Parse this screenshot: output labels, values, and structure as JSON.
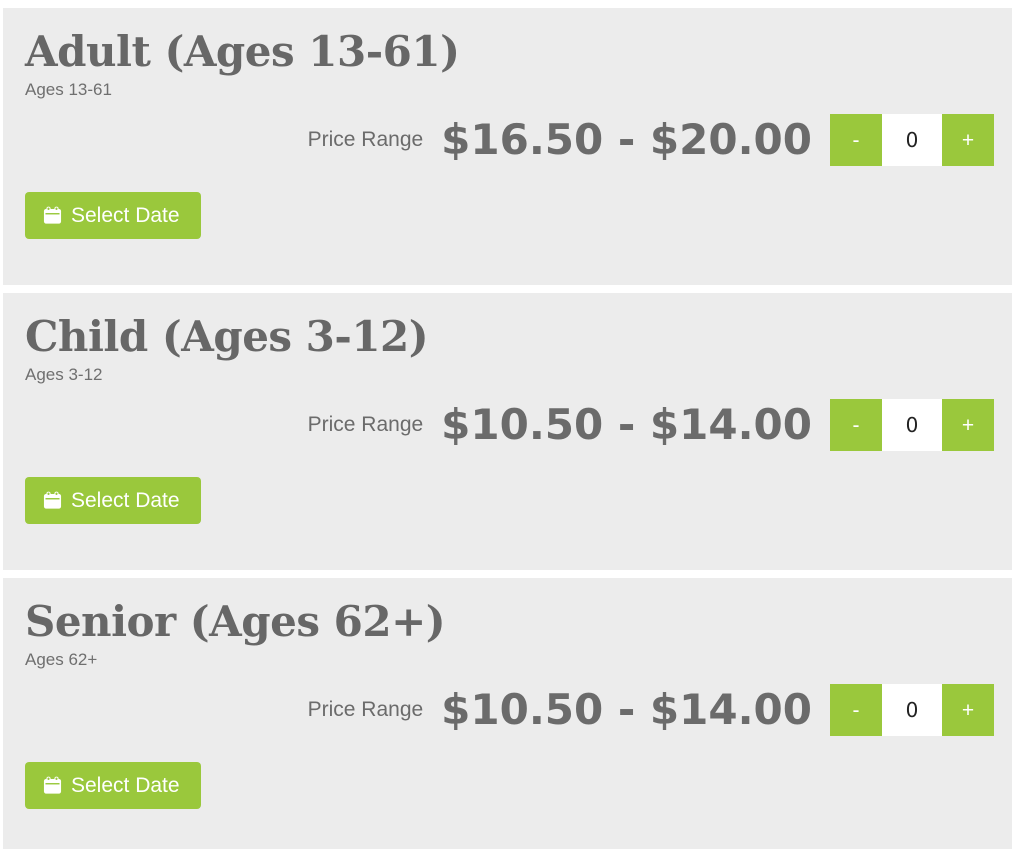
{
  "theme": {
    "accent_green": "#9ac83c",
    "card_background": "#ececec",
    "text_gray": "#6b6b6b",
    "page_background": "#ffffff"
  },
  "common": {
    "price_label": "Price Range",
    "select_date_label": "Select Date",
    "decrement_label": "-",
    "increment_label": "+",
    "calendar_icon": "calendar-icon"
  },
  "tickets": [
    {
      "title": "Adult (Ages 13-61)",
      "subtitle": "Ages 13-61",
      "price_label": "Price Range",
      "price_range": "$16.50 - $20.00",
      "price_min": "$16.50",
      "price_max": "$20.00",
      "quantity": "0",
      "decrement_label": "-",
      "increment_label": "+",
      "select_date_label": "Select Date"
    },
    {
      "title": "Child (Ages 3-12)",
      "subtitle": "Ages 3-12",
      "price_label": "Price Range",
      "price_range": "$10.50 - $14.00",
      "price_min": "$10.50",
      "price_max": "$14.00",
      "quantity": "0",
      "decrement_label": "-",
      "increment_label": "+",
      "select_date_label": "Select Date"
    },
    {
      "title": "Senior (Ages 62+)",
      "subtitle": "Ages 62+",
      "price_label": "Price Range",
      "price_range": "$10.50 - $14.00",
      "price_min": "$10.50",
      "price_max": "$14.00",
      "quantity": "0",
      "decrement_label": "-",
      "increment_label": "+",
      "select_date_label": "Select Date"
    }
  ]
}
